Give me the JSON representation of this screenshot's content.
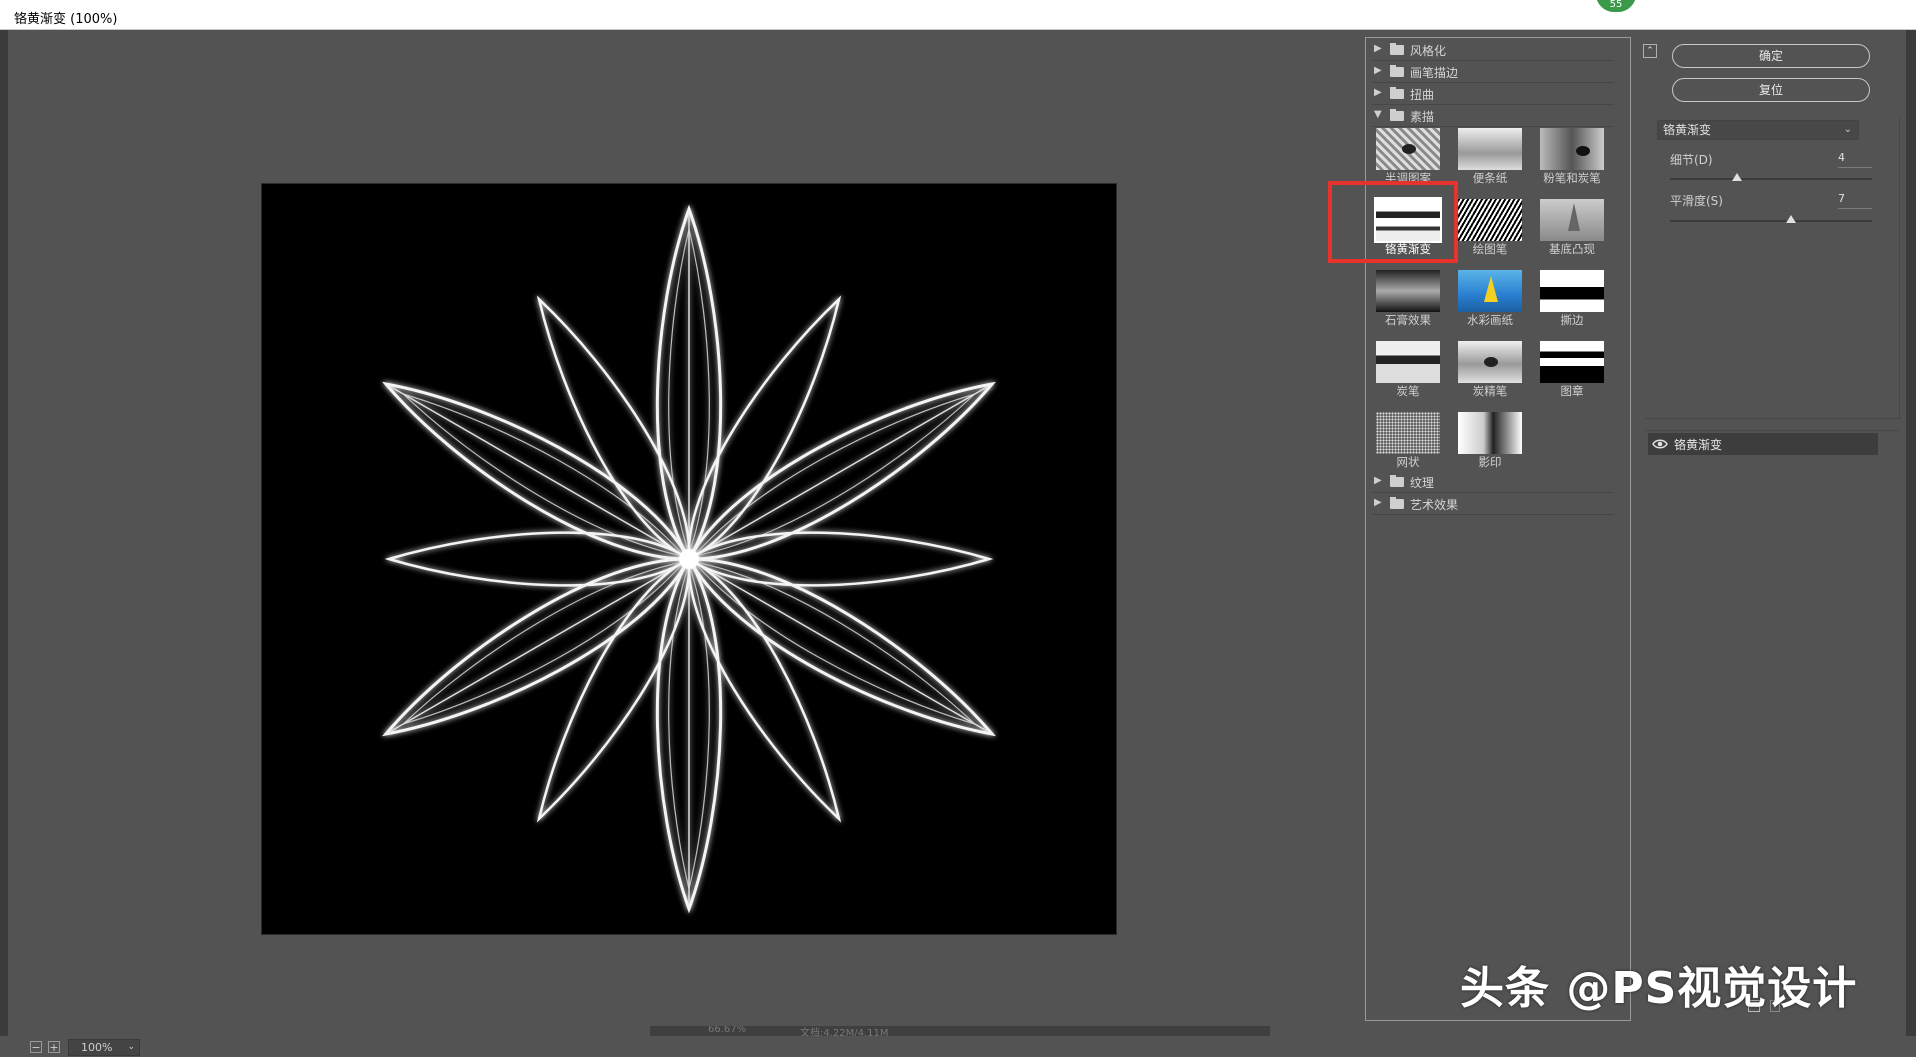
{
  "window": {
    "title": "铬黄渐变 (100%)",
    "badge": "55"
  },
  "preview": {
    "zoom_value": "100%",
    "status_zoom": "66.67%",
    "status_doc": "文档:4.22M/4.11M"
  },
  "gallery": {
    "categories_top": [
      {
        "label": "风格化",
        "expanded": false
      },
      {
        "label": "画笔描边",
        "expanded": false
      },
      {
        "label": "扭曲",
        "expanded": false
      },
      {
        "label": "素描",
        "expanded": true
      }
    ],
    "sketch_filters": [
      {
        "label": "半调图案"
      },
      {
        "label": "便条纸"
      },
      {
        "label": "粉笔和炭笔"
      },
      {
        "label": "铬黄渐变",
        "selected": true
      },
      {
        "label": "绘图笔"
      },
      {
        "label": "基底凸现"
      },
      {
        "label": "石膏效果"
      },
      {
        "label": "水彩画纸"
      },
      {
        "label": "撕边"
      },
      {
        "label": "炭笔"
      },
      {
        "label": "炭精笔"
      },
      {
        "label": "图章"
      },
      {
        "label": "网状"
      },
      {
        "label": "影印"
      }
    ],
    "categories_bottom": [
      {
        "label": "纹理",
        "expanded": false
      },
      {
        "label": "艺术效果",
        "expanded": false
      }
    ]
  },
  "settings": {
    "ok_label": "确定",
    "reset_label": "复位",
    "filter_select": "铬黄渐变",
    "params": [
      {
        "label": "细节(D)",
        "value": "4",
        "fraction": 0.333
      },
      {
        "label": "平滑度(S)",
        "value": "7",
        "fraction": 0.6
      }
    ]
  },
  "layers": {
    "items": [
      {
        "label": "铬黄渐变"
      }
    ]
  },
  "watermark": "头条 @PS视觉设计",
  "colors": {
    "highlight": "#e8322c",
    "panel": "#535353",
    "canvas": "#000000"
  }
}
